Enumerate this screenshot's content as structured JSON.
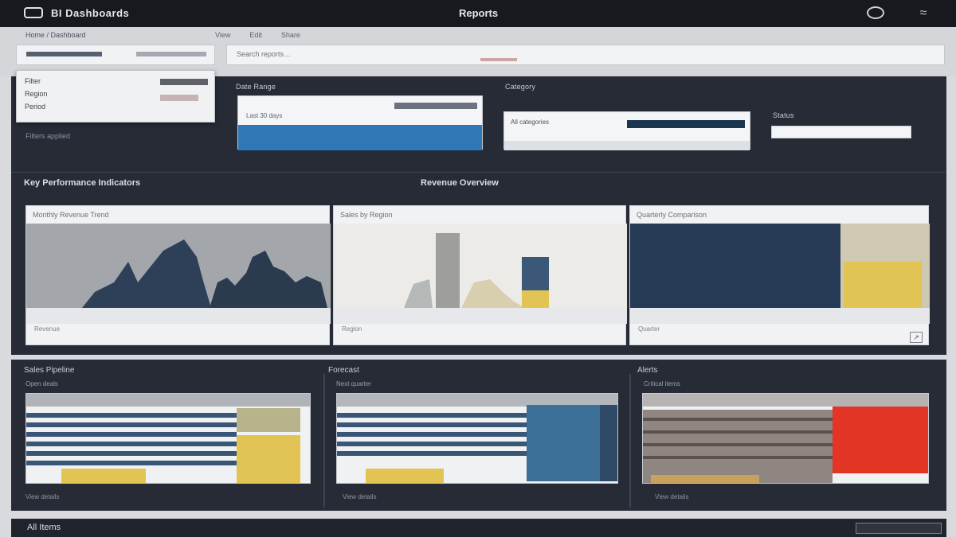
{
  "header": {
    "app_title": "BI Dashboards",
    "page_title": "Reports",
    "globe_icon": "globe-icon",
    "wifi_icon": "wifi-icon",
    "logo_icon": "logo-icon"
  },
  "toolbar": {
    "breadcrumb": "Home / Dashboard",
    "menu_links": [
      "View",
      "Edit",
      "Share"
    ],
    "search_placeholder": "Search reports…"
  },
  "dropdown": {
    "items": [
      "Filter",
      "Region",
      "Period"
    ]
  },
  "filters": {
    "hint": "Filters applied",
    "panels": [
      {
        "title": "Date Range",
        "value": "Last 30 days",
        "accent": "#2f77b5"
      },
      {
        "title": "Category",
        "value": "All categories",
        "accent": "#1b3550"
      },
      {
        "title": "Status",
        "value": ""
      }
    ]
  },
  "section1": {
    "title": "Key Performance Indicators",
    "center_title": "Revenue Overview"
  },
  "charts": [
    {
      "title": "Monthly Revenue Trend",
      "legend": "Revenue"
    },
    {
      "title": "Sales by Region",
      "legend": "Region"
    },
    {
      "title": "Quarterly Comparison",
      "legend": "Quarter"
    }
  ],
  "lower_panels": [
    {
      "title": "Sales Pipeline",
      "subtitle": "Open deals",
      "footer": "View details",
      "accent": "#e2c454"
    },
    {
      "title": "Forecast",
      "subtitle": "Next quarter",
      "footer": "View details",
      "accent": "#3c6f97"
    },
    {
      "title": "Alerts",
      "subtitle": "Critical items",
      "footer": "View details",
      "accent": "#e33525"
    }
  ],
  "bottom_bar": {
    "label": "All Items"
  },
  "colors": {
    "dark_bg": "#262b36",
    "navy": "#2a3f58",
    "blue": "#2f77b5",
    "gold": "#e2c454",
    "red": "#e33525"
  }
}
